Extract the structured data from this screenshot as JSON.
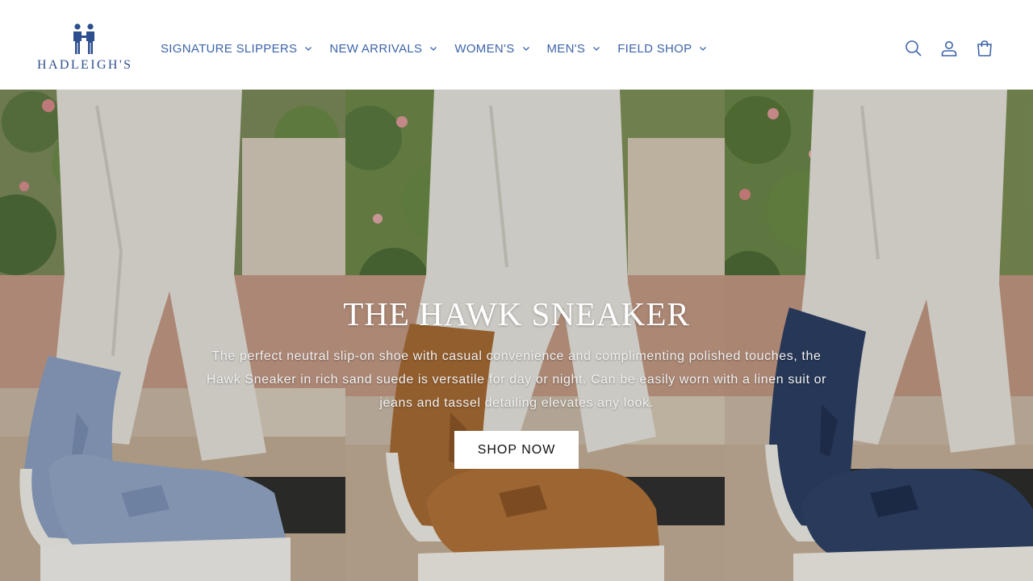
{
  "brand": {
    "name": "HADLEIGH'S",
    "logo_color": "#2e4f8f"
  },
  "nav": {
    "items": [
      {
        "label": "SIGNATURE SLIPPERS"
      },
      {
        "label": "NEW ARRIVALS"
      },
      {
        "label": "WOMEN'S"
      },
      {
        "label": "MEN'S"
      },
      {
        "label": "FIELD SHOP"
      }
    ],
    "link_color": "#3d64a8"
  },
  "header_icons": [
    "search-icon",
    "account-icon",
    "cart-icon"
  ],
  "hero": {
    "title": "THE HAWK SNEAKER",
    "description": "The perfect neutral slip-on shoe with casual convenience and complimenting polished touches, the Hawk Sneaker in rich sand suede is versatile for day or night. Can be easily worn with a linen suit or jeans and tassel detailing elevates any look.",
    "cta_label": "SHOP NOW",
    "panels": [
      {
        "name": "light-blue-suede-sneaker",
        "shoe_color": "#8a9fc1"
      },
      {
        "name": "sand-suede-sneaker",
        "shoe_color": "#a86c35"
      },
      {
        "name": "navy-suede-sneaker",
        "shoe_color": "#2c3f63"
      }
    ]
  }
}
